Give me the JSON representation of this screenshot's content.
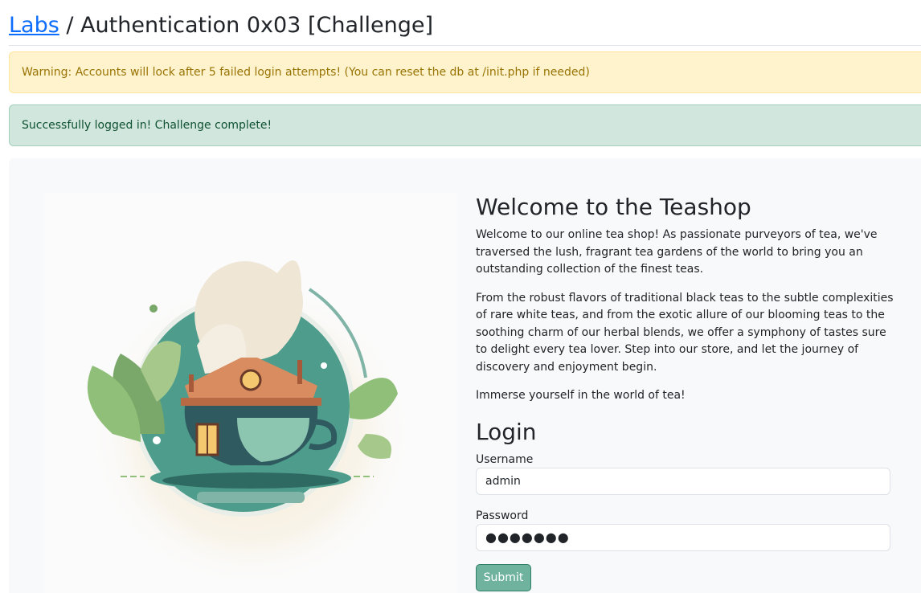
{
  "header": {
    "labs_link": "Labs",
    "separator": " / ",
    "title": "Authentication 0x03 [Challenge]"
  },
  "alerts": {
    "warning": "Warning: Accounts will lock after 5 failed login attempts! (You can reset the db at /init.php if needed)",
    "success": "Successfully logged in! Challenge complete!"
  },
  "main": {
    "welcome_title": "Welcome to the Teashop",
    "paragraphs": [
      "Welcome to our online tea shop! As passionate purveyors of tea, we've traversed the lush, fragrant tea gardens of the world to bring you an outstanding collection of the finest teas.",
      "From the robust flavors of traditional black teas to the subtle complexities of rare white teas, and from the exotic allure of our blooming teas to the soothing charm of our herbal blends, we offer a symphony of tastes sure to delight every tea lover. Step into our store, and let the journey of discovery and enjoyment begin.",
      "Immerse yourself in the world of tea!"
    ]
  },
  "login": {
    "title": "Login",
    "username_label": "Username",
    "username_value": "admin",
    "password_label": "Password",
    "password_value": "●●●●●●●",
    "submit_label": "Submit"
  },
  "colors": {
    "link": "#0d6efd",
    "warning_bg": "#fff3cd",
    "success_bg": "#d1e7dd",
    "button_bg": "#6fb39e"
  }
}
